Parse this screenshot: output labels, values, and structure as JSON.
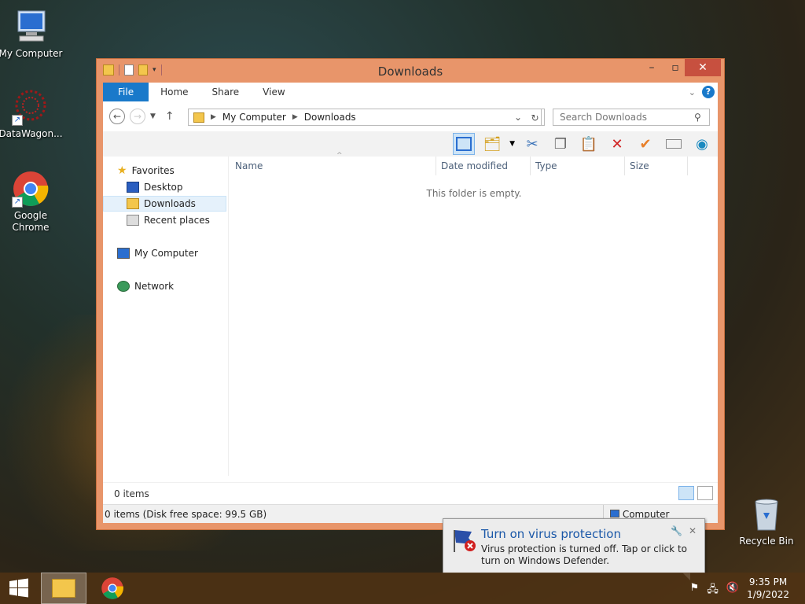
{
  "desktop": {
    "icons": [
      {
        "label": "My Computer"
      },
      {
        "label": "DataWagon..."
      },
      {
        "label": "Google Chrome"
      },
      {
        "label": "Recycle Bin"
      }
    ]
  },
  "window": {
    "title": "Downloads",
    "ribbon_tabs": [
      "File",
      "Home",
      "Share",
      "View"
    ],
    "address": {
      "segments": [
        "My Computer",
        "Downloads"
      ]
    },
    "search_placeholder": "Search Downloads",
    "sidebar": {
      "favorites": "Favorites",
      "items": [
        "Desktop",
        "Downloads",
        "Recent places"
      ],
      "computer": "My Computer",
      "network": "Network"
    },
    "columns": [
      "Name",
      "Date modified",
      "Type",
      "Size"
    ],
    "empty_message": "This folder is empty.",
    "status_items": "0 items",
    "status_bar": "0 items (Disk free space: 99.5 GB)",
    "status_location": "Computer"
  },
  "notification": {
    "title": "Turn on virus protection",
    "body": "Virus protection is turned off. Tap or click to turn on Windows Defender."
  },
  "taskbar": {
    "time": "9:35 PM",
    "date": "1/9/2022"
  },
  "colors": {
    "window_frame": "#e8956a",
    "file_tab": "#1979ca",
    "close_button": "#c7503f",
    "notification_title": "#1b58a8"
  }
}
